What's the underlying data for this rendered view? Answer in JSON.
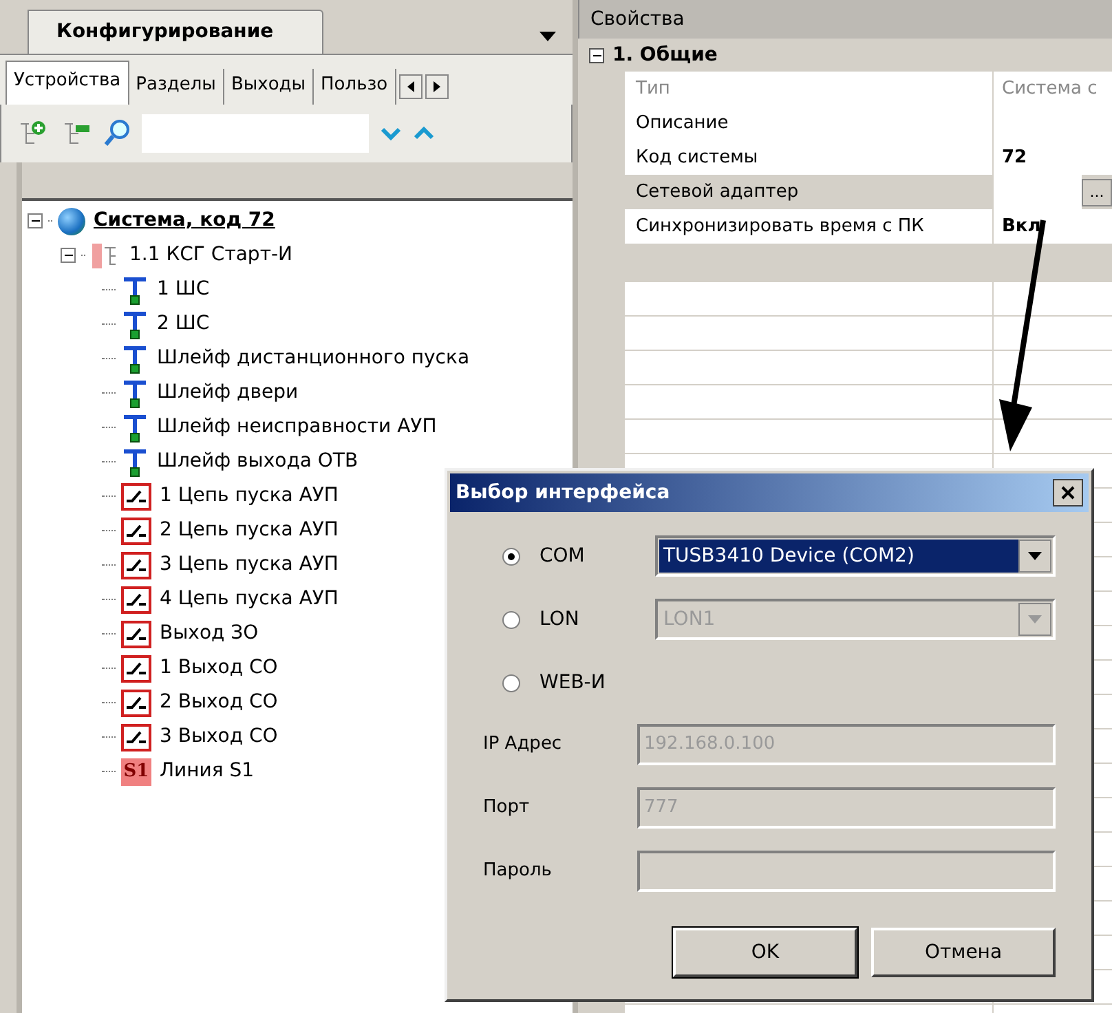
{
  "left_panel": {
    "title": "Конфигурирование",
    "tabs": [
      {
        "label": "Устройства",
        "selected": true
      },
      {
        "label": "Разделы",
        "selected": false
      },
      {
        "label": "Выходы",
        "selected": false
      },
      {
        "label": "Пользо",
        "selected": false
      }
    ],
    "tree": [
      {
        "label": "Система, код 72",
        "kind": "system",
        "expanded": true,
        "children": [
          {
            "label": "1.1 КСГ Старт-И",
            "kind": "device",
            "expanded": true,
            "children": [
              {
                "label": "1 ШС",
                "kind": "loop"
              },
              {
                "label": "2 ШС",
                "kind": "loop"
              },
              {
                "label": "Шлейф дистанционного пуска",
                "kind": "loop"
              },
              {
                "label": "Шлейф двери",
                "kind": "loop"
              },
              {
                "label": "Шлейф неисправности АУП",
                "kind": "loop"
              },
              {
                "label": "Шлейф выхода ОТВ",
                "kind": "loop"
              },
              {
                "label": "1 Цепь пуска АУП",
                "kind": "relay"
              },
              {
                "label": "2 Цепь пуска АУП",
                "kind": "relay"
              },
              {
                "label": "3 Цепь пуска АУП",
                "kind": "relay"
              },
              {
                "label": "4 Цепь пуска АУП",
                "kind": "relay"
              },
              {
                "label": "Выход ЗО",
                "kind": "relay"
              },
              {
                "label": "1 Выход СО",
                "kind": "relay"
              },
              {
                "label": "2 Выход СО",
                "kind": "relay"
              },
              {
                "label": "3 Выход СО",
                "kind": "relay"
              },
              {
                "label": "Линия S1",
                "kind": "line",
                "badge": "S1"
              }
            ]
          }
        ]
      }
    ]
  },
  "properties": {
    "title": "Свойства",
    "section": {
      "label": "1. Общие",
      "expanded": true
    },
    "rows": [
      {
        "name": "Тип",
        "value": "Система с",
        "kind": "readonly",
        "selected": false
      },
      {
        "name": "Описание",
        "kind": "plain",
        "selected": false
      },
      {
        "name": "Код системы",
        "value": "72",
        "kind": "changed",
        "selected": false
      },
      {
        "name": "Сетевой адаптер",
        "kind": "plain",
        "selected": true,
        "button": "..."
      },
      {
        "name": "Синхронизировать время с ПК",
        "value": "Вкл",
        "kind": "changed",
        "selected": false
      }
    ]
  },
  "dialog": {
    "title": "Выбор интерфейса",
    "interfaces": [
      {
        "label": "COM",
        "selected": true,
        "combo": {
          "value": "TUSB3410 Device (COM2)",
          "disabled": false
        }
      },
      {
        "label": "LON",
        "selected": false,
        "combo": {
          "value": "LON1",
          "disabled": true
        }
      },
      {
        "label": "WEB-И",
        "selected": false
      }
    ],
    "fields": [
      {
        "label": "IP Адрес",
        "value": "192.168.0.100",
        "disabled": true
      },
      {
        "label": "Порт",
        "value": "777",
        "disabled": true
      },
      {
        "label": "Пароль",
        "disabled": true
      }
    ],
    "buttons": [
      "OK",
      "Отмена"
    ]
  }
}
